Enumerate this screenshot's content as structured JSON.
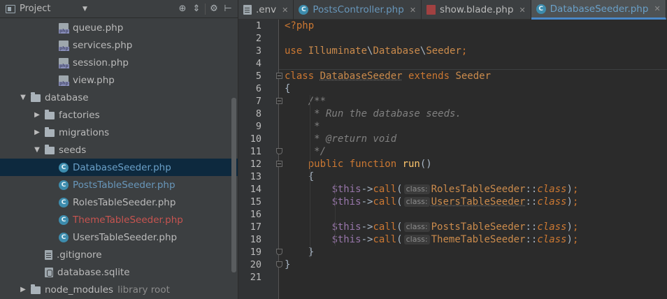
{
  "project_panel": {
    "title": "Project",
    "tools": [
      "target-icon",
      "collapse-icon",
      "gear-icon",
      "hide-icon"
    ],
    "tree": [
      {
        "label": "queue.php",
        "icon": "php-file-icon",
        "style": "norm",
        "depth": 3
      },
      {
        "label": "services.php",
        "icon": "php-file-icon",
        "style": "norm",
        "depth": 3
      },
      {
        "label": "session.php",
        "icon": "php-file-icon",
        "style": "norm",
        "depth": 3
      },
      {
        "label": "view.php",
        "icon": "php-file-icon",
        "style": "norm",
        "depth": 3
      },
      {
        "label": "database",
        "icon": "folder-icon",
        "style": "norm",
        "depth": 1,
        "expanded": true
      },
      {
        "label": "factories",
        "icon": "folder-icon",
        "style": "norm",
        "depth": 2,
        "expanded": false
      },
      {
        "label": "migrations",
        "icon": "folder-icon",
        "style": "norm",
        "depth": 2,
        "expanded": false
      },
      {
        "label": "seeds",
        "icon": "folder-icon",
        "style": "norm",
        "depth": 2,
        "expanded": true
      },
      {
        "label": "DatabaseSeeder.php",
        "icon": "php-class-icon",
        "style": "sel",
        "depth": 3,
        "selected": true
      },
      {
        "label": "PostsTableSeeder.php",
        "icon": "php-class-icon",
        "style": "blue",
        "depth": 3
      },
      {
        "label": "RolesTableSeeder.php",
        "icon": "php-class-icon",
        "style": "norm",
        "depth": 3
      },
      {
        "label": "ThemeTableSeeder.php",
        "icon": "php-class-icon",
        "style": "red",
        "depth": 3
      },
      {
        "label": "UsersTableSeeder.php",
        "icon": "php-class-icon",
        "style": "norm",
        "depth": 3
      },
      {
        "label": ".gitignore",
        "icon": "text-file-icon",
        "style": "norm",
        "depth": 2
      },
      {
        "label": "database.sqlite",
        "icon": "sqlite-file-icon",
        "style": "norm",
        "depth": 2
      },
      {
        "label": "node_modules",
        "icon": "folder-icon",
        "style": "norm",
        "depth": 1,
        "expanded": false,
        "suffix": "library root"
      }
    ]
  },
  "tabs": [
    {
      "label": ".env",
      "icon": "text-file-icon",
      "style": "env",
      "active": false
    },
    {
      "label": "PostsController.php",
      "icon": "php-class-icon",
      "style": "pc",
      "active": false
    },
    {
      "label": "show.blade.php",
      "icon": "blade-file-icon",
      "style": "blade",
      "active": false
    },
    {
      "label": "DatabaseSeeder.php",
      "icon": "php-class-icon",
      "style": "ds",
      "active": true
    }
  ],
  "editor": {
    "line_numbers": [
      "1",
      "2",
      "3",
      "4",
      "5",
      "6",
      "7",
      "8",
      "9",
      "10",
      "11",
      "12",
      "13",
      "14",
      "15",
      "16",
      "17",
      "18",
      "19",
      "20",
      "21"
    ],
    "lines": [
      {
        "n": 1,
        "tokens": [
          [
            "kw",
            "<?php"
          ]
        ]
      },
      {
        "n": 2,
        "tokens": []
      },
      {
        "n": 3,
        "tokens": [
          [
            "kw",
            "use "
          ],
          [
            "tn",
            "Illuminate"
          ],
          [
            "punc",
            "\\"
          ],
          [
            "tn",
            "Database"
          ],
          [
            "punc",
            "\\"
          ],
          [
            "tn",
            "Seeder"
          ],
          [
            "kw",
            ";"
          ]
        ]
      },
      {
        "n": 4,
        "tokens": []
      },
      {
        "n": 5,
        "tokens": [
          [
            "kw",
            "class "
          ],
          [
            "tnu",
            "DatabaseSeeder"
          ],
          [
            "kw",
            " extends "
          ],
          [
            "tn",
            "Seeder"
          ]
        ]
      },
      {
        "n": 6,
        "tokens": [
          [
            "punc",
            "{"
          ]
        ]
      },
      {
        "n": 7,
        "tokens": [
          [
            "punc",
            "    "
          ],
          [
            "cm",
            "/**"
          ]
        ]
      },
      {
        "n": 8,
        "tokens": [
          [
            "punc",
            "    "
          ],
          [
            "cm",
            " * Run the database seeds."
          ]
        ]
      },
      {
        "n": 9,
        "tokens": [
          [
            "punc",
            "    "
          ],
          [
            "cm",
            " *"
          ]
        ]
      },
      {
        "n": 10,
        "tokens": [
          [
            "punc",
            "    "
          ],
          [
            "cm",
            " * @return void"
          ]
        ]
      },
      {
        "n": 11,
        "tokens": [
          [
            "punc",
            "    "
          ],
          [
            "cm",
            " */"
          ]
        ]
      },
      {
        "n": 12,
        "tokens": [
          [
            "punc",
            "    "
          ],
          [
            "kw",
            "public function "
          ],
          [
            "fn",
            "run"
          ],
          [
            "punc",
            "()"
          ]
        ]
      },
      {
        "n": 13,
        "tokens": [
          [
            "punc",
            "    {"
          ]
        ]
      },
      {
        "n": 14,
        "tokens": [
          [
            "punc",
            "        "
          ],
          [
            "var",
            "$this"
          ],
          [
            "punc",
            "->"
          ],
          [
            "kw",
            "call"
          ],
          [
            "punc",
            "("
          ],
          [
            "hint",
            "class:"
          ],
          [
            "tn",
            "RolesTableSeeder"
          ],
          [
            "punc",
            "::"
          ],
          [
            "ital",
            "class"
          ],
          [
            "punc",
            ")"
          ],
          [
            "kw",
            ";"
          ]
        ]
      },
      {
        "n": 15,
        "tokens": [
          [
            "punc",
            "        "
          ],
          [
            "var",
            "$this"
          ],
          [
            "punc",
            "->"
          ],
          [
            "kw",
            "call"
          ],
          [
            "punc",
            "("
          ],
          [
            "hint",
            "class:"
          ],
          [
            "tnu",
            "UsersTableSeeder"
          ],
          [
            "punc",
            "::"
          ],
          [
            "ital",
            "class"
          ],
          [
            "punc",
            ")"
          ],
          [
            "kw",
            ";"
          ]
        ]
      },
      {
        "n": 16,
        "tokens": []
      },
      {
        "n": 17,
        "tokens": [
          [
            "punc",
            "        "
          ],
          [
            "var",
            "$this"
          ],
          [
            "punc",
            "->"
          ],
          [
            "kw",
            "call"
          ],
          [
            "punc",
            "("
          ],
          [
            "hint",
            "class:"
          ],
          [
            "tn",
            "PostsTableSeeder"
          ],
          [
            "punc",
            "::"
          ],
          [
            "ital",
            "class"
          ],
          [
            "punc",
            ")"
          ],
          [
            "kw",
            ";"
          ]
        ]
      },
      {
        "n": 18,
        "tokens": [
          [
            "punc",
            "        "
          ],
          [
            "var",
            "$this"
          ],
          [
            "punc",
            "->"
          ],
          [
            "kw",
            "call"
          ],
          [
            "punc",
            "("
          ],
          [
            "hint",
            "class:"
          ],
          [
            "tn",
            "ThemeTableSeeder"
          ],
          [
            "punc",
            "::"
          ],
          [
            "ital",
            "class"
          ],
          [
            "punc",
            ")"
          ],
          [
            "kw",
            ";"
          ]
        ]
      },
      {
        "n": 19,
        "tokens": [
          [
            "punc",
            "    }"
          ]
        ]
      },
      {
        "n": 20,
        "tokens": [
          [
            "punc",
            "}"
          ]
        ]
      },
      {
        "n": 21,
        "tokens": []
      }
    ]
  }
}
